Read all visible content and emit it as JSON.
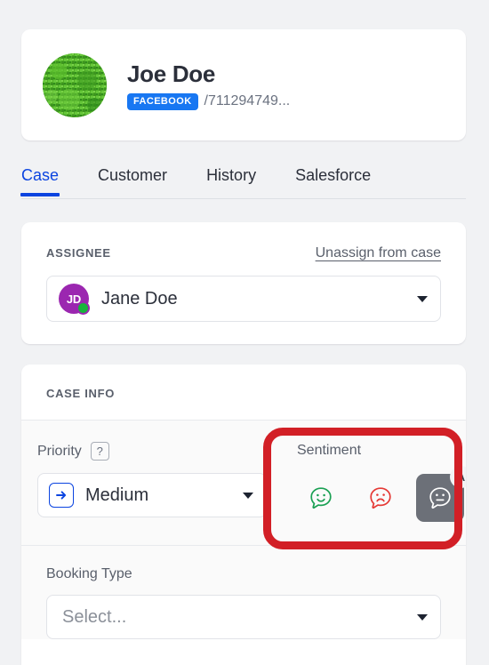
{
  "contact": {
    "name": "Joe Doe",
    "channel_badge": "FACEBOOK",
    "handle": "/711294749...",
    "avatar_alt": "green-texture-avatar"
  },
  "tabs": [
    {
      "label": "Case",
      "active": true
    },
    {
      "label": "Customer",
      "active": false
    },
    {
      "label": "History",
      "active": false
    },
    {
      "label": "Salesforce",
      "active": false
    }
  ],
  "assignee": {
    "section_label": "ASSIGNEE",
    "unassign_label": "Unassign from case",
    "selected": {
      "initials": "JD",
      "name": "Jane Doe",
      "status": "online"
    }
  },
  "case_info": {
    "section_label": "CASE INFO",
    "priority": {
      "label": "Priority",
      "help": "?",
      "value": "Medium"
    },
    "sentiment": {
      "label": "Sentiment",
      "options": [
        {
          "name": "positive",
          "icon": "smiley-face-bubble-icon",
          "color": "#1aa053",
          "selected": false
        },
        {
          "name": "negative",
          "icon": "frowning-face-bubble-icon",
          "color": "#e53935",
          "selected": false
        },
        {
          "name": "neutral",
          "icon": "neutral-face-bubble-icon",
          "color": "#ffffff",
          "selected": true
        }
      ],
      "auto_badge": "A"
    },
    "booking_type": {
      "label": "Booking Type",
      "placeholder": "Select..."
    }
  },
  "annotation": {
    "color": "#d21f26",
    "target": "sentiment"
  },
  "theme": {
    "accent": "#0b44e0",
    "facebook_blue": "#1877f2",
    "page_bg": "#f1f2f4",
    "card_bg": "#ffffff"
  }
}
